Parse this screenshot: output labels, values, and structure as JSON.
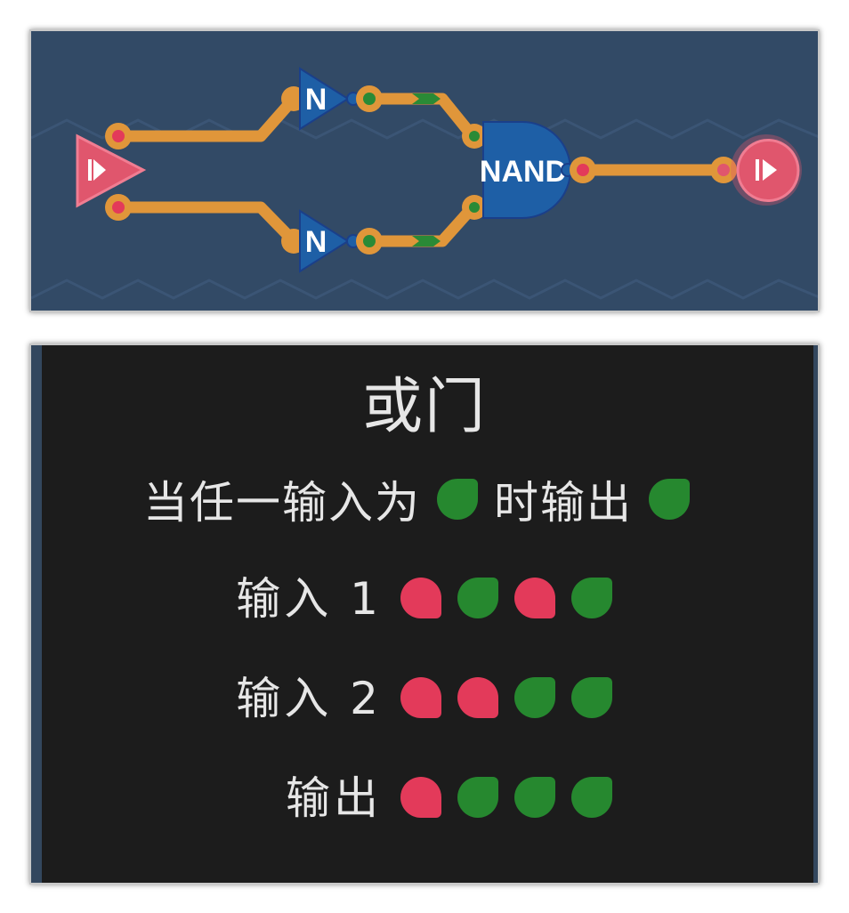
{
  "circuit": {
    "inner_gates": [
      {
        "label": "N"
      },
      {
        "label": "N"
      }
    ],
    "combine_gate": {
      "label": "NAND"
    },
    "colors": {
      "background": "#324a66",
      "wire": "#e0963a",
      "gate_fill": "#1e5fa6",
      "gate_stroke": "#1a3f8a",
      "io_fill": "#e0566d",
      "signal_on": "#2a8a36",
      "signal_off": "#e33a5a"
    }
  },
  "info": {
    "title": "或门",
    "rule": {
      "prefix": "当任一输入为",
      "prefix_state": "on",
      "middle": "时输出",
      "result_state": "on"
    },
    "truth_table": [
      {
        "label": "输入 1",
        "values": [
          "off",
          "on",
          "off",
          "on"
        ]
      },
      {
        "label": "输入 2",
        "values": [
          "off",
          "off",
          "on",
          "on"
        ]
      },
      {
        "label": "输出",
        "values": [
          "off",
          "on",
          "on",
          "on"
        ]
      }
    ]
  }
}
